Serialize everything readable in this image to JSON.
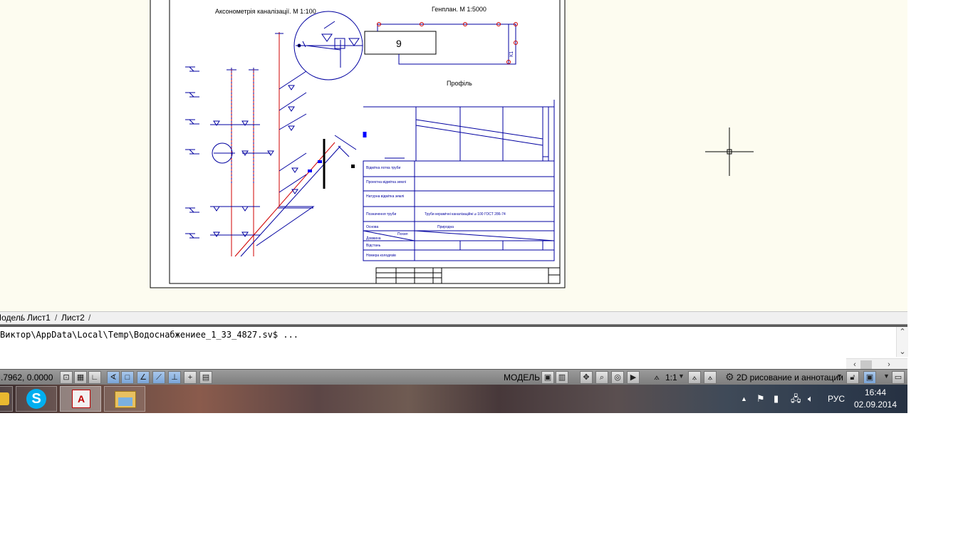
{
  "drawing": {
    "axonometry_title": "Аксонометрія каналізації. М 1:100",
    "genplan_title": "Генплан. М 1:5000",
    "building_number": "9",
    "profile_title": "Профіль",
    "k1_label": "К1",
    "profile_table": {
      "rows": [
        "Відмітка лотка труби",
        "Проектна відмітка землі",
        "Натурна відмітка землі",
        "Позначення труби",
        "Основа",
        "Похил",
        "Довжина",
        "Відстань",
        "Номера колодязів"
      ],
      "pipe_spec": "Труби керамічні каналізаційні ⌀ 100 ГОСТ 286-74",
      "base_value": "Природна"
    }
  },
  "tabs": {
    "model": "Модель",
    "sheet1": "Лист1",
    "sheet2": "Лист2"
  },
  "command_line": {
    "text": "Виктор\\AppData\\Local\\Temp\\Водоснабжениее_1_33_4827.sv$ ..."
  },
  "status_bar": {
    "coordinates": ".7962, 0.0000",
    "model_label": "МОДЕЛЬ",
    "scale_label": "1:1",
    "workspace_label": "2D рисование и аннотации"
  },
  "taskbar": {
    "language": "РУС",
    "time": "16:44",
    "date": "02.09.2014"
  },
  "colors": {
    "canvas_bg": "#fdfcf0",
    "drawing_blue": "#0000a0",
    "drawing_red": "#d00000",
    "active_toggle": "#7aa5d8"
  }
}
